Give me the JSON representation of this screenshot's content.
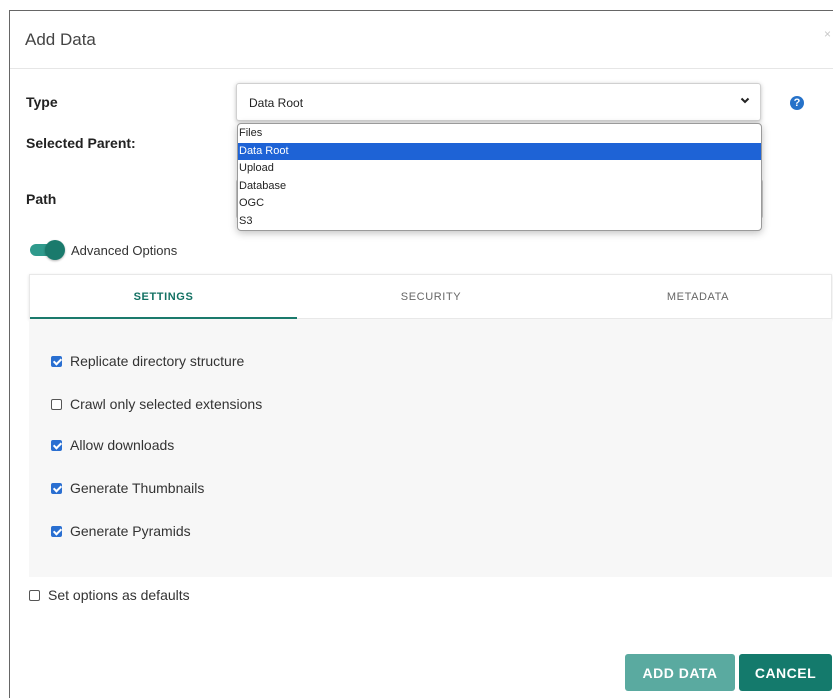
{
  "dialog": {
    "title": "Add Data",
    "close_label": "×"
  },
  "form": {
    "type_label": "Type",
    "selected_parent_label": "Selected Parent:",
    "path_label": "Path",
    "type_select": {
      "value": "Data Root",
      "chevron": "⌄",
      "options": [
        "Files",
        "Data Root",
        "Upload",
        "Database",
        "OGC",
        "S3"
      ],
      "selected_index": 1
    },
    "help_label": "?"
  },
  "advanced": {
    "label": "Advanced Options",
    "enabled": true
  },
  "tabs": [
    {
      "label": "SETTINGS",
      "active": true
    },
    {
      "label": "SECURITY",
      "active": false
    },
    {
      "label": "METADATA",
      "active": false
    }
  ],
  "settings": [
    {
      "label": "Replicate directory structure",
      "checked": true
    },
    {
      "label": "Crawl only selected extensions",
      "checked": false
    },
    {
      "label": "Allow downloads",
      "checked": true
    },
    {
      "label": "Generate Thumbnails",
      "checked": true
    },
    {
      "label": "Generate Pyramids",
      "checked": true
    }
  ],
  "defaults": {
    "label": "Set options as defaults",
    "checked": false
  },
  "buttons": {
    "add_label": "ADD DATA",
    "cancel_label": "CANCEL"
  },
  "colors": {
    "accent": "#147a6c",
    "accent_light": "#5aaaa0",
    "selection": "#1e63d6",
    "checkbox": "#2a6fd1",
    "help": "#2672c9"
  }
}
